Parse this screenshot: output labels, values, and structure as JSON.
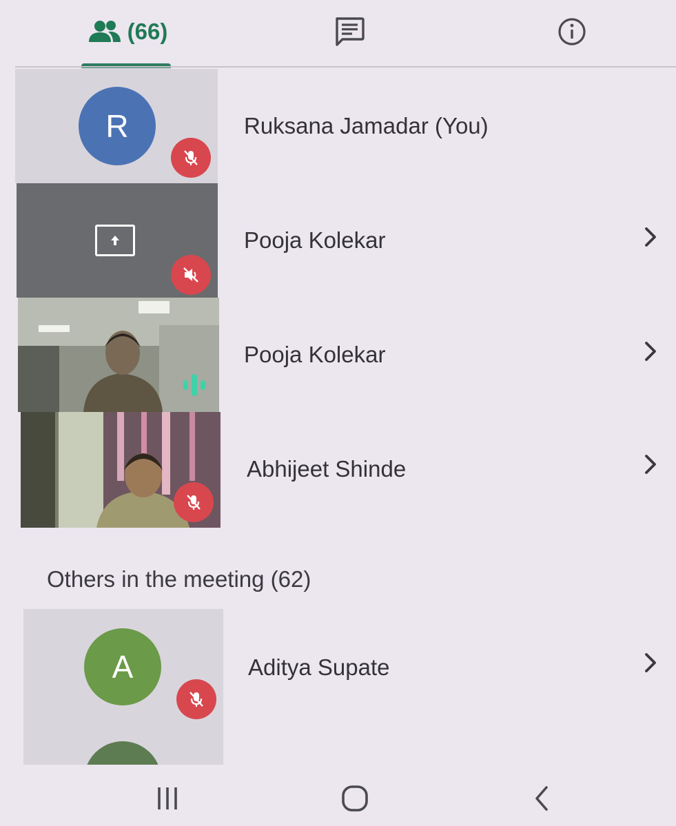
{
  "tabs": {
    "people": {
      "icon": "people-icon",
      "count_label": "(66)",
      "selected": true
    },
    "chat": {
      "icon": "chat-icon"
    },
    "info": {
      "icon": "info-icon"
    }
  },
  "participants": [
    {
      "name": "Ruksana Jamadar (You)",
      "avatar_letter": "R",
      "avatar_color": "#4b73b4",
      "mic": "muted",
      "has_chevron": false
    },
    {
      "name": "Pooja Kolekar",
      "tile": "screen-share",
      "icon": "present-screen-icon",
      "audio": "speaker-muted",
      "has_chevron": true
    },
    {
      "name": "Pooja Kolekar",
      "tile": "camera-video",
      "status": "speaking",
      "has_chevron": true
    },
    {
      "name": "Abhijeet Shinde",
      "tile": "camera-video",
      "mic": "muted",
      "has_chevron": true
    }
  ],
  "others": {
    "label": "Others in the meeting (62)",
    "items": [
      {
        "name": "Aditya Supate",
        "avatar_letter": "A",
        "avatar_color": "#6b9a48",
        "mic": "muted",
        "has_chevron": true
      }
    ]
  },
  "colors": {
    "accent": "#2d7d5e",
    "mute_badge": "#d8474e",
    "speaking": "#3fd2a8",
    "background": "#ece6ef"
  },
  "navbar": {
    "icons": [
      "recent-apps-icon",
      "home-icon",
      "back-icon"
    ]
  }
}
